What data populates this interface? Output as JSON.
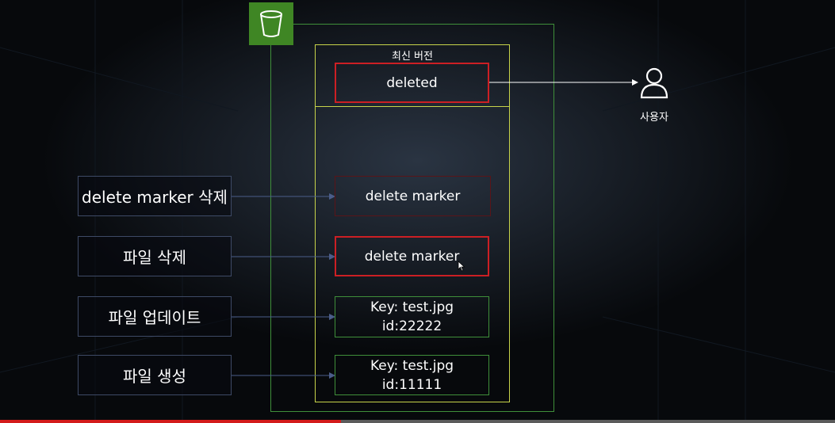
{
  "bucket": {
    "icon": "s3-bucket-icon",
    "color": "#3f8624"
  },
  "latest_version": {
    "label": "최신 버전",
    "value": "deleted"
  },
  "user": {
    "icon": "user-icon",
    "label": "사용자"
  },
  "actions": [
    {
      "label": "delete marker 삭제"
    },
    {
      "label": "파일 삭제"
    },
    {
      "label": "파일 업데이트"
    },
    {
      "label": "파일 생성"
    }
  ],
  "versions": [
    {
      "line1": "delete marker",
      "line2": ""
    },
    {
      "line1": "delete marker",
      "line2": ""
    },
    {
      "line1": "Key: test.jpg",
      "line2": "id:22222"
    },
    {
      "line1": "Key: test.jpg",
      "line2": "id:11111"
    }
  ],
  "colors": {
    "outline_green": "#3f8f3a",
    "outline_yellow": "#c8d44a",
    "marker_red": "#cc1f24",
    "arrow": "#4b5d8a"
  }
}
